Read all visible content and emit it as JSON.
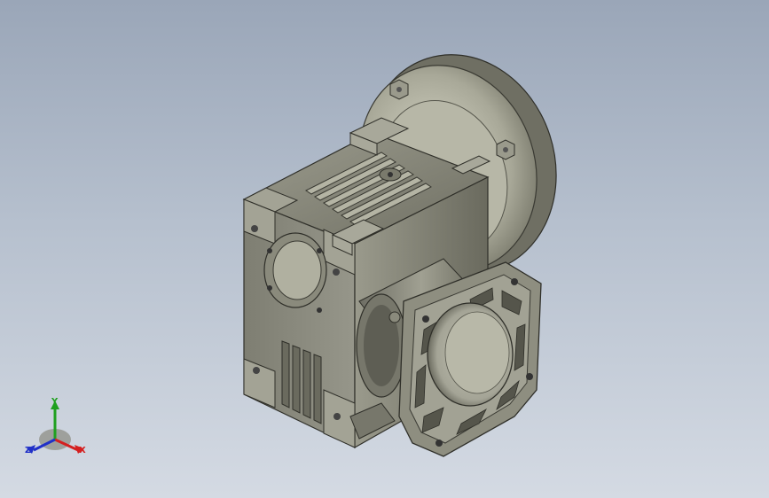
{
  "viewport": {
    "background_top": "#9aa6b8",
    "background_bottom": "#d4dae3",
    "model_color": "#8e8e80",
    "model_dark": "#4a4a42",
    "model_light": "#c8c8b8"
  },
  "triad": {
    "x_label": "X",
    "y_label": "Y",
    "z_label": "Z",
    "x_color": "#d42020",
    "y_color": "#1fa01f",
    "z_color": "#2030c8"
  }
}
